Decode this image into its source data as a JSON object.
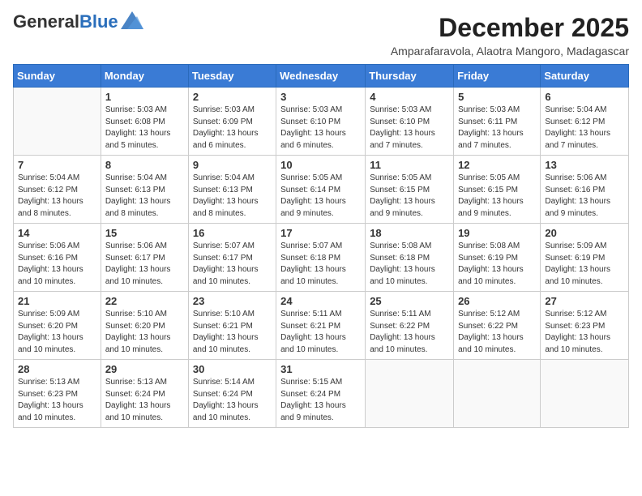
{
  "header": {
    "logo_general": "General",
    "logo_blue": "Blue",
    "month_year": "December 2025",
    "location": "Amparafaravola, Alaotra Mangoro, Madagascar"
  },
  "weekdays": [
    "Sunday",
    "Monday",
    "Tuesday",
    "Wednesday",
    "Thursday",
    "Friday",
    "Saturday"
  ],
  "weeks": [
    [
      {
        "day": "",
        "sunrise": "",
        "sunset": "",
        "daylight": ""
      },
      {
        "day": "1",
        "sunrise": "Sunrise: 5:03 AM",
        "sunset": "Sunset: 6:08 PM",
        "daylight": "Daylight: 13 hours and 5 minutes."
      },
      {
        "day": "2",
        "sunrise": "Sunrise: 5:03 AM",
        "sunset": "Sunset: 6:09 PM",
        "daylight": "Daylight: 13 hours and 6 minutes."
      },
      {
        "day": "3",
        "sunrise": "Sunrise: 5:03 AM",
        "sunset": "Sunset: 6:10 PM",
        "daylight": "Daylight: 13 hours and 6 minutes."
      },
      {
        "day": "4",
        "sunrise": "Sunrise: 5:03 AM",
        "sunset": "Sunset: 6:10 PM",
        "daylight": "Daylight: 13 hours and 7 minutes."
      },
      {
        "day": "5",
        "sunrise": "Sunrise: 5:03 AM",
        "sunset": "Sunset: 6:11 PM",
        "daylight": "Daylight: 13 hours and 7 minutes."
      },
      {
        "day": "6",
        "sunrise": "Sunrise: 5:04 AM",
        "sunset": "Sunset: 6:12 PM",
        "daylight": "Daylight: 13 hours and 7 minutes."
      }
    ],
    [
      {
        "day": "7",
        "sunrise": "Sunrise: 5:04 AM",
        "sunset": "Sunset: 6:12 PM",
        "daylight": "Daylight: 13 hours and 8 minutes."
      },
      {
        "day": "8",
        "sunrise": "Sunrise: 5:04 AM",
        "sunset": "Sunset: 6:13 PM",
        "daylight": "Daylight: 13 hours and 8 minutes."
      },
      {
        "day": "9",
        "sunrise": "Sunrise: 5:04 AM",
        "sunset": "Sunset: 6:13 PM",
        "daylight": "Daylight: 13 hours and 8 minutes."
      },
      {
        "day": "10",
        "sunrise": "Sunrise: 5:05 AM",
        "sunset": "Sunset: 6:14 PM",
        "daylight": "Daylight: 13 hours and 9 minutes."
      },
      {
        "day": "11",
        "sunrise": "Sunrise: 5:05 AM",
        "sunset": "Sunset: 6:15 PM",
        "daylight": "Daylight: 13 hours and 9 minutes."
      },
      {
        "day": "12",
        "sunrise": "Sunrise: 5:05 AM",
        "sunset": "Sunset: 6:15 PM",
        "daylight": "Daylight: 13 hours and 9 minutes."
      },
      {
        "day": "13",
        "sunrise": "Sunrise: 5:06 AM",
        "sunset": "Sunset: 6:16 PM",
        "daylight": "Daylight: 13 hours and 9 minutes."
      }
    ],
    [
      {
        "day": "14",
        "sunrise": "Sunrise: 5:06 AM",
        "sunset": "Sunset: 6:16 PM",
        "daylight": "Daylight: 13 hours and 10 minutes."
      },
      {
        "day": "15",
        "sunrise": "Sunrise: 5:06 AM",
        "sunset": "Sunset: 6:17 PM",
        "daylight": "Daylight: 13 hours and 10 minutes."
      },
      {
        "day": "16",
        "sunrise": "Sunrise: 5:07 AM",
        "sunset": "Sunset: 6:17 PM",
        "daylight": "Daylight: 13 hours and 10 minutes."
      },
      {
        "day": "17",
        "sunrise": "Sunrise: 5:07 AM",
        "sunset": "Sunset: 6:18 PM",
        "daylight": "Daylight: 13 hours and 10 minutes."
      },
      {
        "day": "18",
        "sunrise": "Sunrise: 5:08 AM",
        "sunset": "Sunset: 6:18 PM",
        "daylight": "Daylight: 13 hours and 10 minutes."
      },
      {
        "day": "19",
        "sunrise": "Sunrise: 5:08 AM",
        "sunset": "Sunset: 6:19 PM",
        "daylight": "Daylight: 13 hours and 10 minutes."
      },
      {
        "day": "20",
        "sunrise": "Sunrise: 5:09 AM",
        "sunset": "Sunset: 6:19 PM",
        "daylight": "Daylight: 13 hours and 10 minutes."
      }
    ],
    [
      {
        "day": "21",
        "sunrise": "Sunrise: 5:09 AM",
        "sunset": "Sunset: 6:20 PM",
        "daylight": "Daylight: 13 hours and 10 minutes."
      },
      {
        "day": "22",
        "sunrise": "Sunrise: 5:10 AM",
        "sunset": "Sunset: 6:20 PM",
        "daylight": "Daylight: 13 hours and 10 minutes."
      },
      {
        "day": "23",
        "sunrise": "Sunrise: 5:10 AM",
        "sunset": "Sunset: 6:21 PM",
        "daylight": "Daylight: 13 hours and 10 minutes."
      },
      {
        "day": "24",
        "sunrise": "Sunrise: 5:11 AM",
        "sunset": "Sunset: 6:21 PM",
        "daylight": "Daylight: 13 hours and 10 minutes."
      },
      {
        "day": "25",
        "sunrise": "Sunrise: 5:11 AM",
        "sunset": "Sunset: 6:22 PM",
        "daylight": "Daylight: 13 hours and 10 minutes."
      },
      {
        "day": "26",
        "sunrise": "Sunrise: 5:12 AM",
        "sunset": "Sunset: 6:22 PM",
        "daylight": "Daylight: 13 hours and 10 minutes."
      },
      {
        "day": "27",
        "sunrise": "Sunrise: 5:12 AM",
        "sunset": "Sunset: 6:23 PM",
        "daylight": "Daylight: 13 hours and 10 minutes."
      }
    ],
    [
      {
        "day": "28",
        "sunrise": "Sunrise: 5:13 AM",
        "sunset": "Sunset: 6:23 PM",
        "daylight": "Daylight: 13 hours and 10 minutes."
      },
      {
        "day": "29",
        "sunrise": "Sunrise: 5:13 AM",
        "sunset": "Sunset: 6:24 PM",
        "daylight": "Daylight: 13 hours and 10 minutes."
      },
      {
        "day": "30",
        "sunrise": "Sunrise: 5:14 AM",
        "sunset": "Sunset: 6:24 PM",
        "daylight": "Daylight: 13 hours and 10 minutes."
      },
      {
        "day": "31",
        "sunrise": "Sunrise: 5:15 AM",
        "sunset": "Sunset: 6:24 PM",
        "daylight": "Daylight: 13 hours and 9 minutes."
      },
      {
        "day": "",
        "sunrise": "",
        "sunset": "",
        "daylight": ""
      },
      {
        "day": "",
        "sunrise": "",
        "sunset": "",
        "daylight": ""
      },
      {
        "day": "",
        "sunrise": "",
        "sunset": "",
        "daylight": ""
      }
    ]
  ]
}
